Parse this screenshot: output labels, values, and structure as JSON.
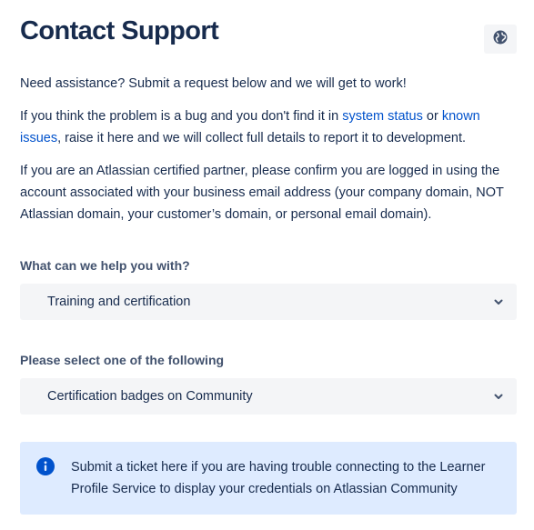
{
  "header": {
    "title": "Contact Support",
    "language_icon": "globe-icon"
  },
  "intro": {
    "p1": "Need assistance? Submit a request below and we will get to work!",
    "p2_before": "If you think the problem is a bug and you don't find it in ",
    "p2_link1": "system status",
    "p2_mid": " or ",
    "p2_link2": "known issues",
    "p2_after": ", raise it here and we will collect full details to report it to development.",
    "p3": "If you are an Atlassian certified partner, please confirm you are logged in using the account associated with your business email address (your company domain, NOT Atlassian domain, your customer’s domain, or personal email domain)."
  },
  "form": {
    "help_label": "What can we help you with?",
    "help_value": "Training and certification",
    "option_label": "Please select one of the following",
    "option_value": "Certification badges on Community"
  },
  "info": {
    "icon": "info-icon",
    "text": "Submit a ticket here if you are having trouble connecting to the Learner Profile Service to display your credentials on Atlassian Community"
  },
  "colors": {
    "heading": "#172b4d",
    "link": "#0052cc",
    "label": "#42526e",
    "field_bg": "#f4f5f7",
    "info_bg": "#deebff",
    "info_icon": "#0052cc"
  }
}
